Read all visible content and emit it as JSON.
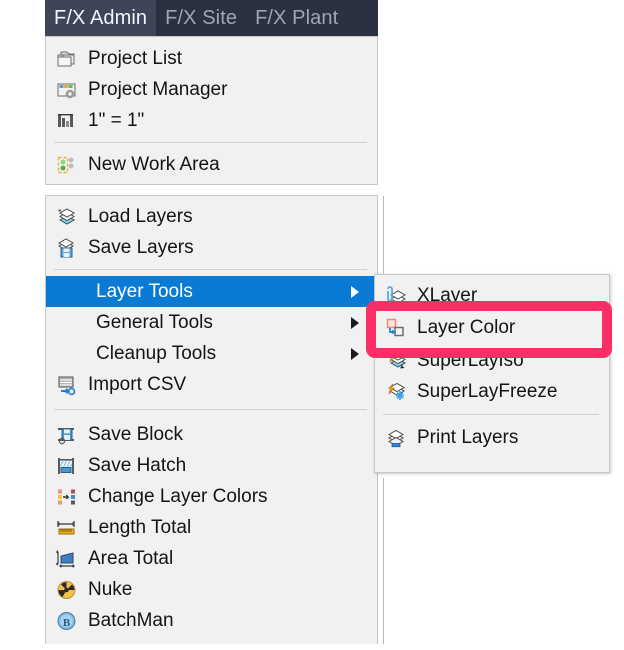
{
  "app": {
    "ribbon_tabs": [
      {
        "label": "F/X Admin",
        "active": true
      },
      {
        "label": "F/X Site",
        "active": false
      },
      {
        "label": "F/X Plant",
        "active": false
      }
    ],
    "accent_blue": "#0a7bd4",
    "annotation_pink": "#fb2e66",
    "menu_background": "#f1f1f1",
    "ribbon_background": "#2b3140"
  },
  "menu_top": {
    "items": [
      {
        "label": "Project List",
        "icon": "folders-icon"
      },
      {
        "label": "Project Manager",
        "icon": "folder-gear-icon"
      },
      {
        "label": "1\" = 1\"",
        "icon": "scale-icon"
      },
      {
        "label": "New Work Area",
        "icon": "work-area-icon"
      }
    ]
  },
  "menu_main": {
    "items": [
      {
        "label": "Load Layers",
        "icon": "load-layers-icon",
        "submenu": false,
        "selected": false
      },
      {
        "label": "Save Layers",
        "icon": "save-layers-icon",
        "submenu": false,
        "selected": false
      },
      {
        "separator": true
      },
      {
        "label": "Layer Tools",
        "icon": null,
        "submenu": true,
        "selected": true
      },
      {
        "label": "General Tools",
        "icon": null,
        "submenu": true,
        "selected": false
      },
      {
        "label": "Cleanup Tools",
        "icon": null,
        "submenu": true,
        "selected": false
      },
      {
        "label": "Import CSV",
        "icon": "import-csv-icon",
        "submenu": false,
        "selected": false
      },
      {
        "separator": true
      },
      {
        "label": "Save Block",
        "icon": "save-block-icon",
        "submenu": false,
        "selected": false
      },
      {
        "label": "Save Hatch",
        "icon": "save-hatch-icon",
        "submenu": false,
        "selected": false
      },
      {
        "label": "Change Layer Colors",
        "icon": "change-layer-colors-icon",
        "submenu": false,
        "selected": false
      },
      {
        "label": "Length Total",
        "icon": "length-total-icon",
        "submenu": false,
        "selected": false
      },
      {
        "label": "Area Total",
        "icon": "area-total-icon",
        "submenu": false,
        "selected": false
      },
      {
        "label": "Nuke",
        "icon": "nuke-icon",
        "submenu": false,
        "selected": false
      },
      {
        "label": "BatchMan",
        "icon": "batchman-icon",
        "submenu": false,
        "selected": false
      }
    ]
  },
  "submenu_layer_tools": {
    "items": [
      {
        "label": "XLayer",
        "icon": "xlayer-icon",
        "highlighted": false
      },
      {
        "label": "Layer Color",
        "icon": "layer-color-icon",
        "highlighted": true
      },
      {
        "label": "SuperLayIso",
        "icon": "superlayiso-icon",
        "highlighted": false
      },
      {
        "label": "SuperLayFreeze",
        "icon": "superlayfreeze-icon",
        "highlighted": false
      },
      {
        "separator": true
      },
      {
        "label": "Print Layers",
        "icon": "print-layers-icon",
        "highlighted": false
      }
    ]
  }
}
